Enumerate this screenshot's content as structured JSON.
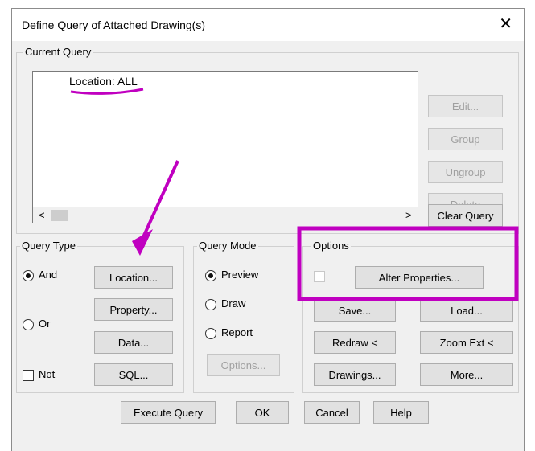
{
  "dialog": {
    "title": "Define Query of Attached Drawing(s)",
    "close_glyph": "✕"
  },
  "current_query": {
    "legend": "Current Query",
    "text": "Location: ALL",
    "scroll_left": "<",
    "scroll_right": ">",
    "buttons": {
      "edit": "Edit...",
      "group": "Group",
      "ungroup": "Ungroup",
      "delete": "Delete",
      "clear": "Clear Query"
    }
  },
  "query_type": {
    "legend": "Query Type",
    "and_label": "And",
    "or_label": "Or",
    "not_label": "Not",
    "and_selected": true,
    "or_selected": false,
    "not_checked": false,
    "buttons": {
      "location": "Location...",
      "property": "Property...",
      "data": "Data...",
      "sql": "SQL..."
    }
  },
  "query_mode": {
    "legend": "Query Mode",
    "preview_label": "Preview",
    "draw_label": "Draw",
    "report_label": "Report",
    "selected": "Preview",
    "options_button": "Options..."
  },
  "options": {
    "legend": "Options",
    "alter_properties_button": "Alter Properties...",
    "buttons": {
      "save": "Save...",
      "load": "Load...",
      "redraw": "Redraw <",
      "zoom_ext": "Zoom Ext <",
      "drawings": "Drawings...",
      "more": "More..."
    }
  },
  "footer": {
    "execute": "Execute Query",
    "ok": "OK",
    "cancel": "Cancel",
    "help": "Help"
  },
  "colors": {
    "annotation": "#c000c0"
  }
}
